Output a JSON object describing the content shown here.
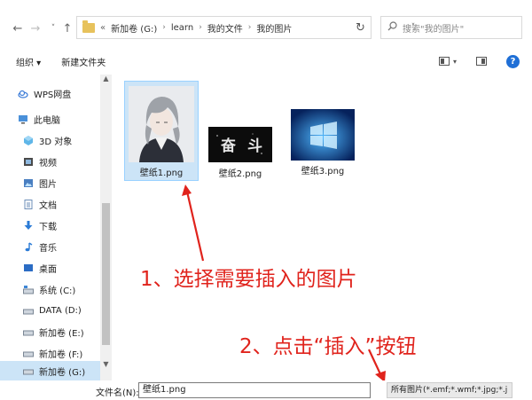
{
  "address_bar": {
    "back_label": "←",
    "forward_label": "→",
    "history_label": "˅",
    "up_label": "↑",
    "overflow": "«",
    "breadcrumbs": [
      "新加卷 (G:)",
      "learn",
      "我的文件",
      "我的图片"
    ],
    "separator": "›",
    "dropdown": "˅",
    "refresh": "↻"
  },
  "search": {
    "placeholder": "搜索\"我的图片\""
  },
  "toolbar": {
    "organize_label": "组织 ▾",
    "new_folder_label": "新建文件夹",
    "help_label": "?"
  },
  "sidebar": {
    "items": [
      {
        "label": "WPS网盘",
        "icon": "cloud-icon"
      },
      {
        "label": "此电脑",
        "icon": "computer-icon"
      },
      {
        "label": "3D 对象",
        "icon": "cube-icon"
      },
      {
        "label": "视频",
        "icon": "video-icon"
      },
      {
        "label": "图片",
        "icon": "picture-icon"
      },
      {
        "label": "文档",
        "icon": "document-icon"
      },
      {
        "label": "下载",
        "icon": "download-icon"
      },
      {
        "label": "音乐",
        "icon": "music-icon"
      },
      {
        "label": "桌面",
        "icon": "desktop-icon"
      },
      {
        "label": "系统 (C:)",
        "icon": "drive-icon"
      },
      {
        "label": "DATA (D:)",
        "icon": "drive-icon"
      },
      {
        "label": "新加卷 (E:)",
        "icon": "drive-icon"
      },
      {
        "label": "新加卷 (F:)",
        "icon": "drive-icon"
      },
      {
        "label": "新加卷 (G:)",
        "icon": "drive-icon"
      }
    ],
    "selected_index": 13
  },
  "files": [
    {
      "name": "壁纸1.png",
      "selected": true
    },
    {
      "name": "壁纸2.png",
      "selected": false
    },
    {
      "name": "壁纸3.png",
      "selected": false
    }
  ],
  "thumb_text": {
    "left": "奋",
    "right": "斗"
  },
  "annotations": {
    "step1": "1、选择需要插入的图片",
    "step2": "2、点击“插入”按钮"
  },
  "bottom": {
    "filename_label": "文件名(N):",
    "filename_value": "壁纸1.png",
    "filetype_value": "所有图片(*.emf;*.wmf;*.jpg;*.j"
  },
  "colors": {
    "accent": "#1f6fd6",
    "selection": "#cce4f7",
    "annotation": "#e0231c"
  }
}
